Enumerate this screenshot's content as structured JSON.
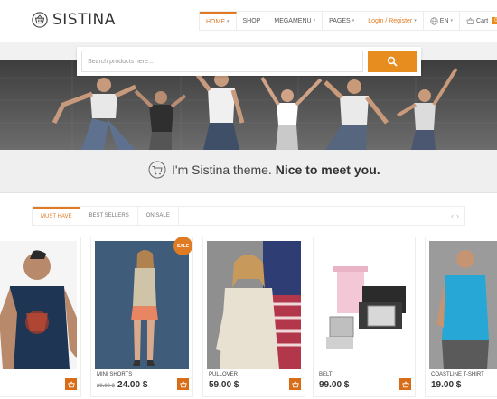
{
  "brand": {
    "name": "SISTINA"
  },
  "nav": {
    "items": [
      {
        "label": "HOME",
        "caret": true
      },
      {
        "label": "SHOP",
        "caret": false
      },
      {
        "label": "MEGAMENU",
        "caret": true
      },
      {
        "label": "PAGES",
        "caret": true
      },
      {
        "label": "Login / Register",
        "caret": true
      },
      {
        "label": "EN",
        "caret": true
      },
      {
        "label": "Cart",
        "caret": false
      }
    ],
    "cart_count": "0",
    "caret_glyph": "▾"
  },
  "search": {
    "placeholder": "Search products here..."
  },
  "tagline": {
    "regular": "I'm Sistina theme.",
    "bold": "Nice to meet you."
  },
  "tabs": [
    "MUST HAVE",
    "BEST SELLERS",
    "ON SALE"
  ],
  "tab_arrows": {
    "prev": "‹",
    "next": "›"
  },
  "sale_badge": "SALE",
  "products": [
    {
      "name": "",
      "old_price": "",
      "price": ""
    },
    {
      "name": "MINI SHORTS",
      "old_price": "29.00 $",
      "price": "24.00 $"
    },
    {
      "name": "PULLOVER",
      "old_price": "",
      "price": "59.00 $"
    },
    {
      "name": "BELT",
      "old_price": "",
      "price": "99.00 $"
    },
    {
      "name": "COASTLINE T-SHIRT",
      "old_price": "",
      "price": "19.00 $"
    }
  ],
  "colors": {
    "accent": "#e07b24",
    "button": "#e78c1f"
  }
}
